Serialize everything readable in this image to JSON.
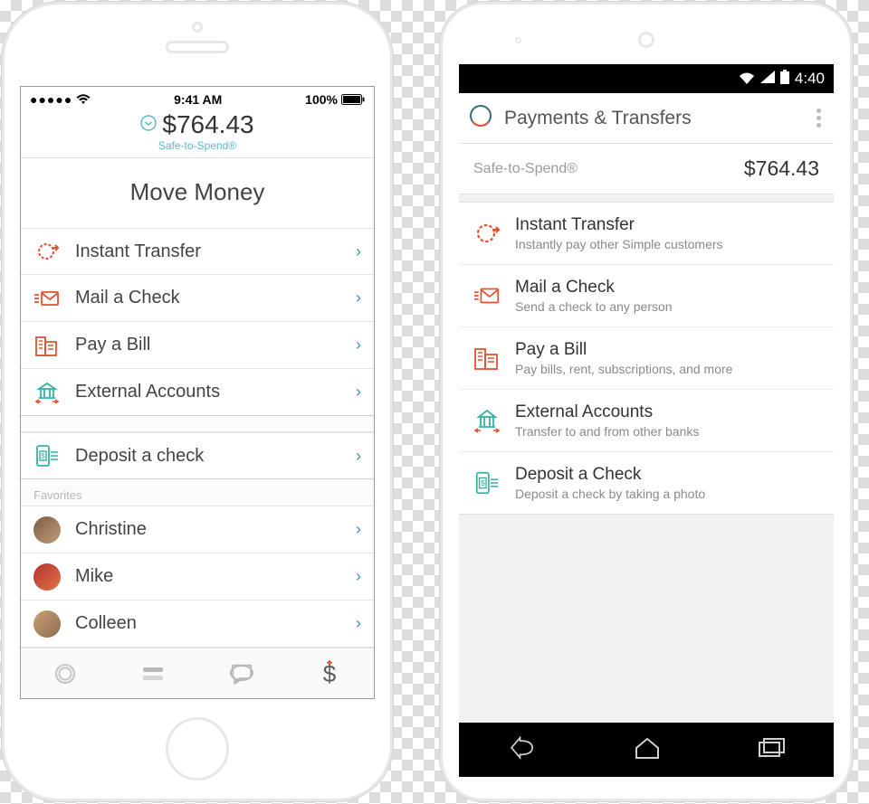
{
  "ios": {
    "status": {
      "carrier_dots": "●●●●●",
      "time": "9:41 AM",
      "battery_pct": "100%"
    },
    "balance": {
      "amount": "$764.43",
      "label": "Safe-to-Spend®"
    },
    "title": "Move Money",
    "group1": [
      {
        "label": "Instant Transfer",
        "icon": "instant-transfer-icon"
      },
      {
        "label": "Mail a Check",
        "icon": "mail-check-icon"
      },
      {
        "label": "Pay a Bill",
        "icon": "pay-bill-icon"
      },
      {
        "label": "External Accounts",
        "icon": "external-accounts-icon"
      }
    ],
    "group2": [
      {
        "label": "Deposit a check",
        "icon": "deposit-check-icon"
      }
    ],
    "favorites_header": "Favorites",
    "favorites": [
      {
        "label": "Christine"
      },
      {
        "label": "Mike"
      },
      {
        "label": "Colleen"
      }
    ],
    "tabbar": [
      {
        "name": "logo-tab-icon"
      },
      {
        "name": "list-tab-icon"
      },
      {
        "name": "chat-tab-icon"
      },
      {
        "name": "money-tab-icon"
      }
    ]
  },
  "android": {
    "status": {
      "time": "4:40"
    },
    "header": {
      "title": "Payments & Transfers"
    },
    "safe_to_spend": {
      "label": "Safe-to-Spend®",
      "amount": "$764.43"
    },
    "items": [
      {
        "title": "Instant Transfer",
        "subtitle": "Instantly pay other Simple customers",
        "icon": "instant-transfer-icon"
      },
      {
        "title": "Mail a Check",
        "subtitle": "Send a check to any person",
        "icon": "mail-check-icon"
      },
      {
        "title": "Pay a Bill",
        "subtitle": "Pay bills, rent, subscriptions, and more",
        "icon": "pay-bill-icon"
      },
      {
        "title": "External Accounts",
        "subtitle": "Transfer to and from other banks",
        "icon": "external-accounts-icon"
      },
      {
        "title": "Deposit a Check",
        "subtitle": "Deposit a check by taking a photo",
        "icon": "deposit-check-icon"
      }
    ],
    "nav": [
      {
        "name": "back-nav-icon"
      },
      {
        "name": "home-nav-icon"
      },
      {
        "name": "recent-nav-icon"
      }
    ]
  },
  "colors": {
    "accent_red": "#e5512f",
    "accent_teal": "#2fb3a2",
    "chevron_blue": "#3d97b5"
  }
}
